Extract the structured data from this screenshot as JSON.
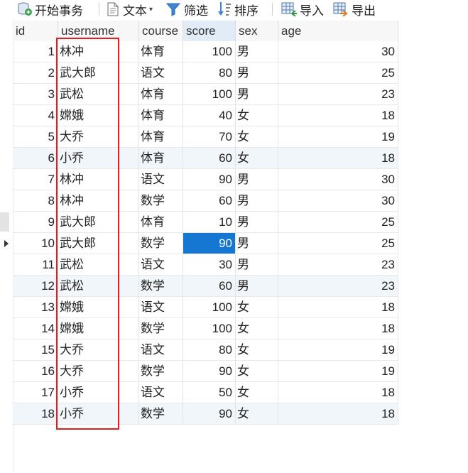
{
  "toolbar": {
    "begin_transaction": "开始事务",
    "text": "文本",
    "filter": "筛选",
    "sort": "排序",
    "import": "导入",
    "export": "导出"
  },
  "columns": [
    "id",
    "username",
    "course",
    "score",
    "sex",
    "age"
  ],
  "sorted_column": "score",
  "rows": [
    {
      "id": "1",
      "username": "林冲",
      "course": "体育",
      "score": "100",
      "sex": "男",
      "age": "30"
    },
    {
      "id": "2",
      "username": "武大郎",
      "course": "语文",
      "score": "80",
      "sex": "男",
      "age": "25"
    },
    {
      "id": "3",
      "username": "武松",
      "course": "体育",
      "score": "100",
      "sex": "男",
      "age": "23"
    },
    {
      "id": "4",
      "username": "嫦娥",
      "course": "体育",
      "score": "40",
      "sex": "女",
      "age": "18"
    },
    {
      "id": "5",
      "username": "大乔",
      "course": "体育",
      "score": "70",
      "sex": "女",
      "age": "19"
    },
    {
      "id": "6",
      "username": "小乔",
      "course": "体育",
      "score": "60",
      "sex": "女",
      "age": "18"
    },
    {
      "id": "7",
      "username": "林冲",
      "course": "语文",
      "score": "90",
      "sex": "男",
      "age": "30"
    },
    {
      "id": "8",
      "username": "林冲",
      "course": "数学",
      "score": "60",
      "sex": "男",
      "age": "30"
    },
    {
      "id": "9",
      "username": "武大郎",
      "course": "体育",
      "score": "10",
      "sex": "男",
      "age": "25"
    },
    {
      "id": "10",
      "username": "武大郎",
      "course": "数学",
      "score": "90",
      "sex": "男",
      "age": "25"
    },
    {
      "id": "11",
      "username": "武松",
      "course": "语文",
      "score": "30",
      "sex": "男",
      "age": "23"
    },
    {
      "id": "12",
      "username": "武松",
      "course": "数学",
      "score": "60",
      "sex": "男",
      "age": "23"
    },
    {
      "id": "13",
      "username": "嫦娥",
      "course": "语文",
      "score": "100",
      "sex": "女",
      "age": "18"
    },
    {
      "id": "14",
      "username": "嫦娥",
      "course": "数学",
      "score": "100",
      "sex": "女",
      "age": "18"
    },
    {
      "id": "15",
      "username": "大乔",
      "course": "语文",
      "score": "80",
      "sex": "女",
      "age": "19"
    },
    {
      "id": "16",
      "username": "大乔",
      "course": "数学",
      "score": "90",
      "sex": "女",
      "age": "19"
    },
    {
      "id": "17",
      "username": "小乔",
      "course": "语文",
      "score": "50",
      "sex": "女",
      "age": "18"
    },
    {
      "id": "18",
      "username": "小乔",
      "course": "数学",
      "score": "90",
      "sex": "女",
      "age": "18"
    }
  ],
  "current_row": 9,
  "selected_cell": {
    "row": 9,
    "column": "score"
  },
  "alt_rows": [
    5,
    11,
    17
  ],
  "colors": {
    "selection": "#1677d2",
    "highlight_box": "#e02020",
    "alt_row": "#f1f6fb"
  }
}
